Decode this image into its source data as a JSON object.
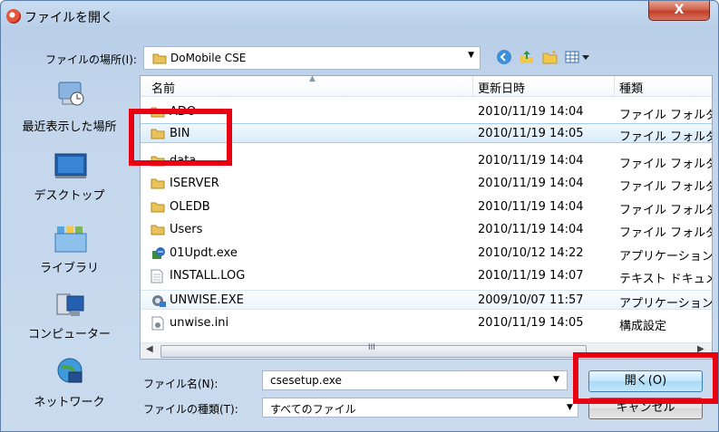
{
  "window": {
    "title": "ファイルを開く",
    "close_label": "X"
  },
  "location": {
    "label": "ファイルの場所(I):",
    "value": "DoMobile CSE"
  },
  "places": [
    {
      "label": "最近表示した場所",
      "icon": "recent-places-icon"
    },
    {
      "label": "デスクトップ",
      "icon": "desktop-icon"
    },
    {
      "label": "ライブラリ",
      "icon": "library-icon"
    },
    {
      "label": "コンピューター",
      "icon": "computer-icon"
    },
    {
      "label": "ネットワーク",
      "icon": "network-icon"
    }
  ],
  "columns": {
    "name": "名前",
    "date": "更新日時",
    "type": "種類"
  },
  "files": [
    {
      "name": "ADO",
      "date": "2010/11/19 14:04",
      "type": "ファイル フォルダー",
      "icon": "folder-icon"
    },
    {
      "name": "BIN",
      "date": "2010/11/19 14:05",
      "type": "ファイル フォルダー",
      "icon": "folder-icon"
    },
    {
      "name": "data",
      "date": "2010/11/19 14:04",
      "type": "ファイル フォルダー",
      "icon": "folder-icon"
    },
    {
      "name": "ISERVER",
      "date": "2010/11/19 14:04",
      "type": "ファイル フォルダー",
      "icon": "folder-icon"
    },
    {
      "name": "OLEDB",
      "date": "2010/11/19 14:04",
      "type": "ファイル フォルダー",
      "icon": "folder-icon"
    },
    {
      "name": "Users",
      "date": "2010/11/19 14:04",
      "type": "ファイル フォルダー",
      "icon": "folder-icon"
    },
    {
      "name": "01Updt.exe",
      "date": "2010/10/12 14:22",
      "type": "アプリケーション",
      "icon": "exe-icon"
    },
    {
      "name": "INSTALL.LOG",
      "date": "2010/11/19 14:07",
      "type": "テキスト ドキュメント",
      "icon": "text-file-icon"
    },
    {
      "name": "UNWISE.EXE",
      "date": "2009/10/07 11:57",
      "type": "アプリケーション",
      "icon": "exe-icon"
    },
    {
      "name": "unwise.ini",
      "date": "2010/11/19 14:05",
      "type": "構成設定",
      "icon": "ini-file-icon"
    }
  ],
  "filename": {
    "label": "ファイル名(N):",
    "value": "csesetup.exe"
  },
  "filetype": {
    "label": "ファイルの種類(T):",
    "value": "すべてのファイル"
  },
  "buttons": {
    "open": "開く(O)",
    "cancel": "キャンセル"
  },
  "accent_colors": {
    "highlight_box": "#e60012",
    "selection": "#d9ecfb"
  }
}
